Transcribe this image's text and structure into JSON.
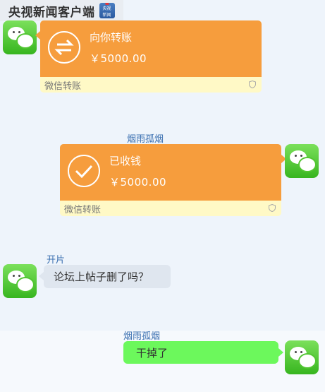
{
  "header": {
    "title": "央视新闻客户端",
    "logo_text": "央视新闻"
  },
  "messages": [
    {
      "type": "transfer",
      "side": "left",
      "label": "向你转账",
      "amount": "￥5000.00",
      "footer": "微信转账",
      "icon": "transfer-arrows-icon"
    },
    {
      "type": "transfer",
      "side": "right",
      "sender": "烟雨孤烟",
      "label": "已收钱",
      "amount": "￥5000.00",
      "footer": "微信转账",
      "icon": "checkmark-icon"
    },
    {
      "type": "text",
      "side": "left",
      "sender": "开片",
      "text": "论坛上帖子删了吗？"
    },
    {
      "type": "text",
      "side": "right",
      "sender": "烟雨孤烟",
      "text": "干掉了"
    }
  ],
  "colors": {
    "transfer_orange": "#f69d3d",
    "sent_bubble": "#6cf85c",
    "received_bubble": "#dfe6ef",
    "name_blue": "#3a6fb0"
  }
}
